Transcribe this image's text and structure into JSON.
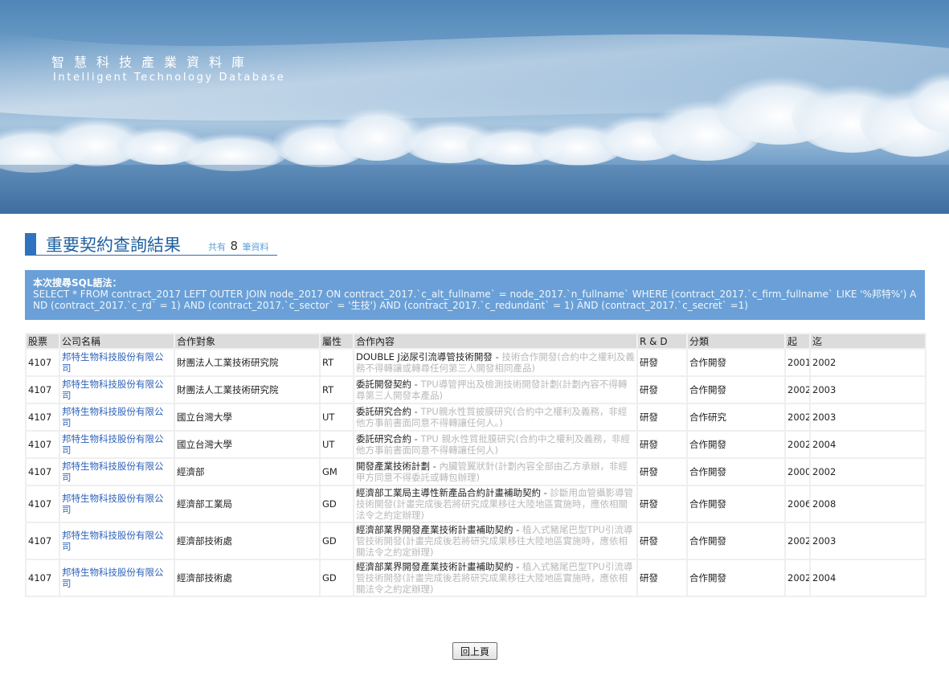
{
  "banner": {
    "title_zh": "智慧科技產業資料庫",
    "title_en": "Intelligent Technology Database"
  },
  "heading": {
    "title": "重要契約查詢結果",
    "count_prefix": "共有",
    "count": "8",
    "count_suffix": "筆資料"
  },
  "sql": {
    "label": "本次搜尋SQL語法：",
    "query": "SELECT * FROM contract_2017 LEFT OUTER JOIN node_2017 ON contract_2017.`c_alt_fullname` = node_2017.`n_fullname` WHERE (contract_2017.`c_firm_fullname` LIKE '%邦特%') AND (contract_2017.`c_rd` = 1) AND (contract_2017.`c_sector` = '生技') AND (contract_2017.`c_redundant` = 1) AND (contract_2017.`c_secret` =1)"
  },
  "table": {
    "headers": [
      "股票",
      "公司名稱",
      "合作對象",
      "屬性",
      "合作內容",
      "R & D",
      "分類",
      "起",
      "迄"
    ],
    "rows": [
      {
        "stock": "4107",
        "company": "邦特生物科技股份有限公司",
        "partner": "財團法人工業技術研究院",
        "attr": "RT",
        "title": "DOUBLE J泌尿引流導管技術開發",
        "desc": "技術合作開發(合約中之權利及義務不得轉讓或轉尋任何第三人開發相同產品)",
        "rd": "研發",
        "category": "合作開發",
        "start": "2001",
        "end": "2002"
      },
      {
        "stock": "4107",
        "company": "邦特生物科技股份有限公司",
        "partner": "財團法人工業技術研究院",
        "attr": "RT",
        "title": "委託開發契約",
        "desc": "TPU導管押出及檢測技術開發計劃(計劃內容不得轉尋第三人開發本產品)",
        "rd": "研發",
        "category": "合作開發",
        "start": "2002",
        "end": "2003"
      },
      {
        "stock": "4107",
        "company": "邦特生物科技股份有限公司",
        "partner": "國立台灣大學",
        "attr": "UT",
        "title": "委託研究合約",
        "desc": "TPU親水性質披膜研究(合約中之權利及義務，非經他方事前書面同意不得轉讓任何人。)",
        "rd": "研發",
        "category": "合作研究",
        "start": "2002",
        "end": "2003"
      },
      {
        "stock": "4107",
        "company": "邦特生物科技股份有限公司",
        "partner": "國立台灣大學",
        "attr": "UT",
        "title": "委託研究合約",
        "desc": "TPU 親水性質批膜研究(合約中之權利及義務，非經他方事前書面同意不得轉讓任何人)",
        "rd": "研發",
        "category": "合作開發",
        "start": "2002",
        "end": "2004"
      },
      {
        "stock": "4107",
        "company": "邦特生物科技股份有限公司",
        "partner": "經濟部",
        "attr": "GM",
        "title": "開發產業技術計劃",
        "desc": "內臟管翼狀針(計劃內容全部由乙方承辦，非經甲方同意不得委託或轉包辦理)",
        "rd": "研發",
        "category": "合作開發",
        "start": "2000",
        "end": "2002"
      },
      {
        "stock": "4107",
        "company": "邦特生物科技股份有限公司",
        "partner": "經濟部工業局",
        "attr": "GD",
        "title": "經濟部工業局主導性新產品合約計畫補助契約",
        "desc": "診斷用血管攝影導管技術開發(計畫完成後若將研究成果移往大陸地區實施時，應依相關法令之約定辦理)",
        "rd": "研發",
        "category": "合作開發",
        "start": "2006",
        "end": "2008"
      },
      {
        "stock": "4107",
        "company": "邦特生物科技股份有限公司",
        "partner": "經濟部技術處",
        "attr": "GD",
        "title": "經濟部業界開發產業技術計畫補助契約",
        "desc": "植入式豬尾巴型TPU引流導管技術開發(計畫完成後若將研究成果移往大陸地區實施時，應依相關法令之約定辦理)",
        "rd": "研發",
        "category": "合作開發",
        "start": "2002",
        "end": "2003"
      },
      {
        "stock": "4107",
        "company": "邦特生物科技股份有限公司",
        "partner": "經濟部技術處",
        "attr": "GD",
        "title": "經濟部業界開發產業技術計畫補助契約",
        "desc": "植入式豬尾巴型TPU引流導管技術開發(計畫完成後若將研究成果移往大陸地區實施時，應依相關法令之約定辦理)",
        "rd": "研發",
        "category": "合作開發",
        "start": "2002",
        "end": "2004"
      }
    ]
  },
  "back_button": "回上頁"
}
